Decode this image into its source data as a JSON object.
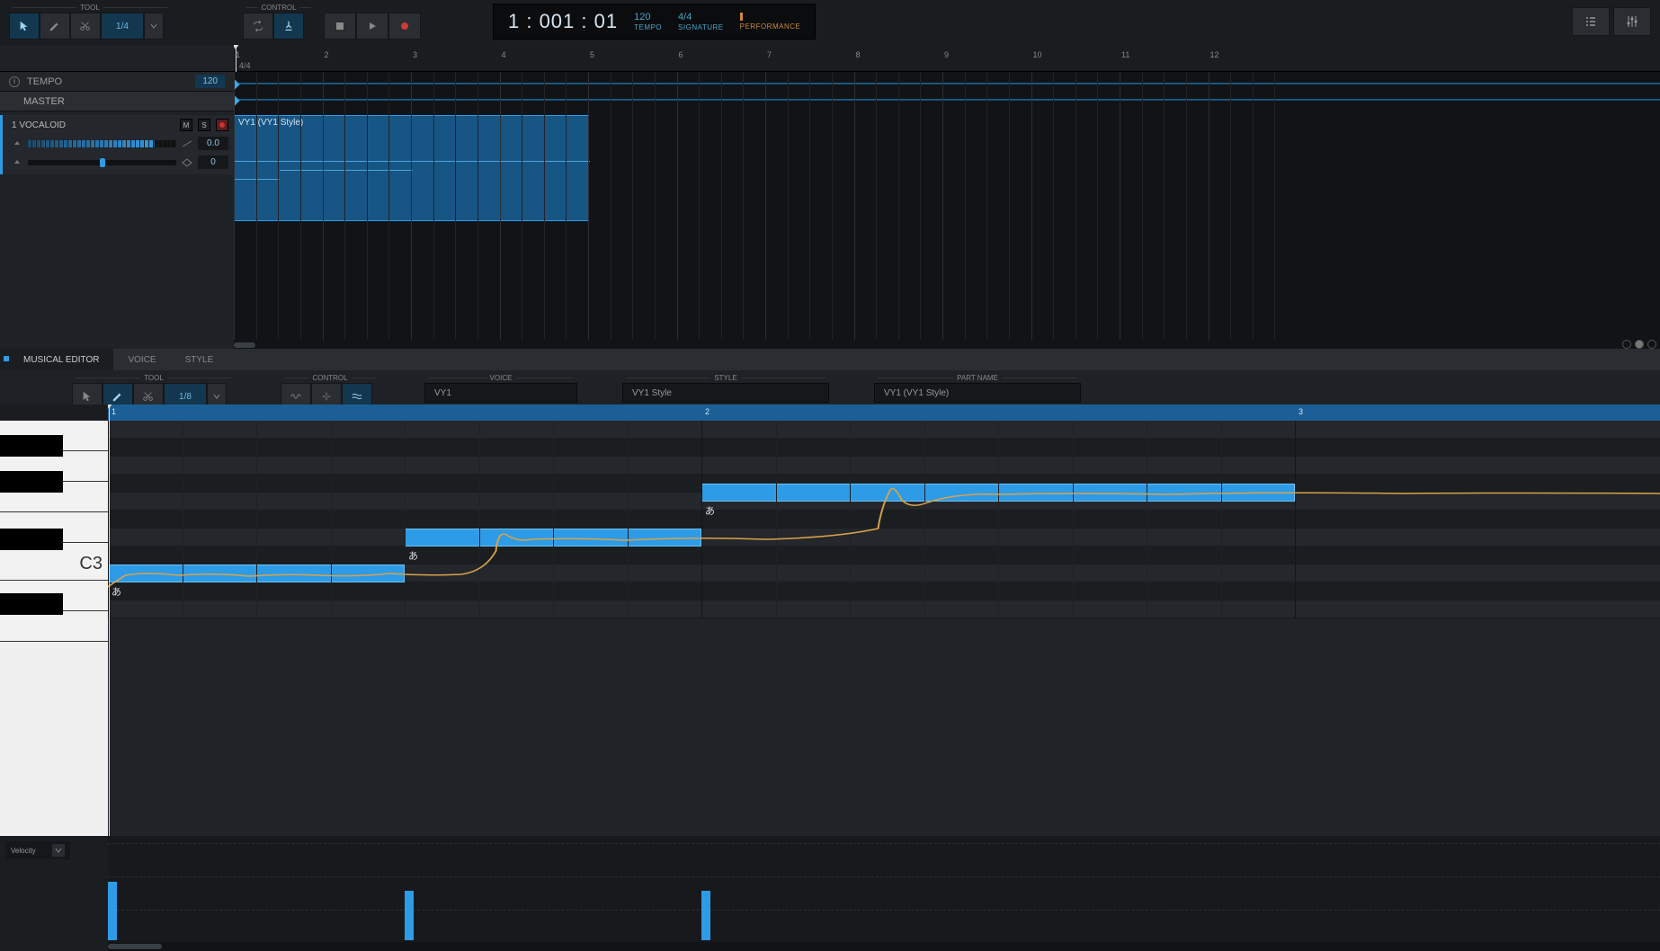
{
  "toolbar": {
    "tool_label": "TOOL",
    "control_label": "CONTROL",
    "quantize": "1/4",
    "tempo_value": "120",
    "tempo_label": "TEMPO",
    "signature_value": "4/4",
    "signature_label": "SIGNATURE",
    "performance_label": "PERFORMANCE",
    "song_position": "1 : 001 : 01"
  },
  "trackpanel": {
    "tempo_title": "TEMPO",
    "tempo_box": "120",
    "master_title": "MASTER",
    "track": {
      "name": "1 VOCALOID",
      "mute": "M",
      "solo": "S",
      "volume": "0.0",
      "pan": "0"
    }
  },
  "timeline": {
    "signature": "4/4",
    "bars": [
      "1",
      "2",
      "3",
      "4",
      "5",
      "6",
      "7",
      "8",
      "9",
      "10",
      "11",
      "12"
    ],
    "clip_name": "VY1 (VY1 Style)"
  },
  "midtabs": {
    "musical": "MUSICAL EDITOR",
    "voice": "VOICE",
    "style": "STYLE"
  },
  "me": {
    "tool_label": "TOOL",
    "control_label": "CONTROL",
    "voice_label": "VOICE",
    "style_label": "STYLE",
    "partname_label": "PART NAME",
    "quantize": "1/8",
    "voice": "VY1",
    "style": "VY1 Style",
    "partname": "VY1 (VY1 Style)"
  },
  "pianoroll": {
    "bars": [
      "1",
      "2",
      "3"
    ],
    "c_label": "C3",
    "notes": [
      {
        "lyric": "あ"
      },
      {
        "lyric": "あ"
      },
      {
        "lyric": "あ"
      }
    ]
  },
  "velocity": {
    "label": "Velocity"
  }
}
